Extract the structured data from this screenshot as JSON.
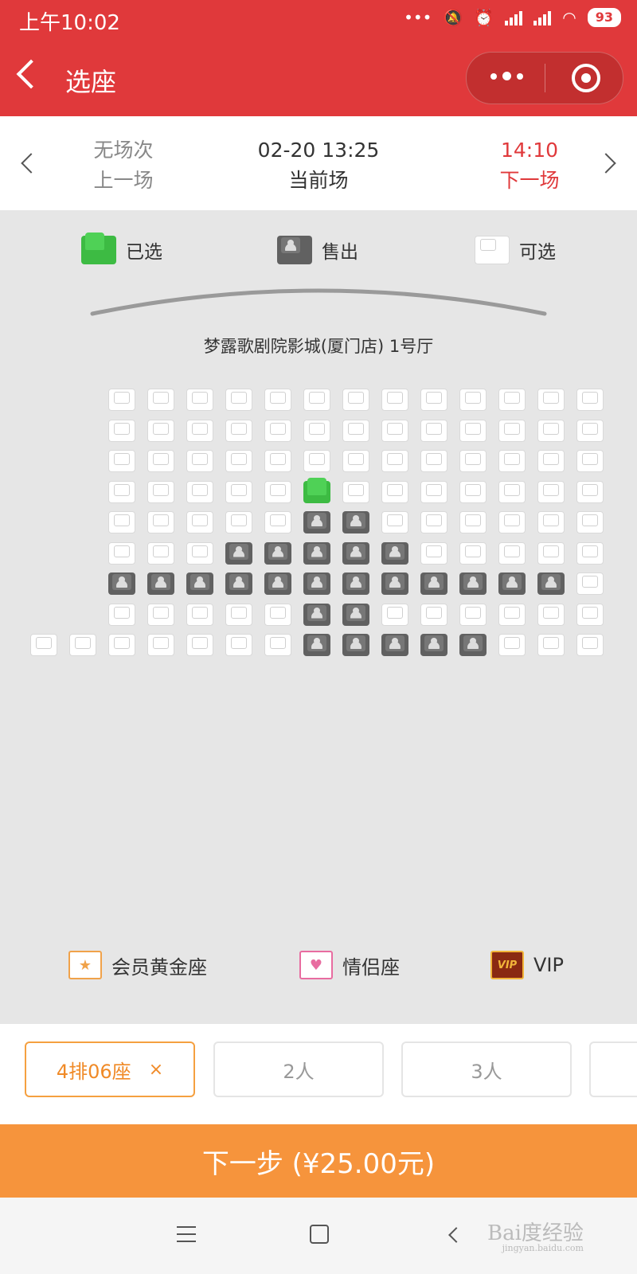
{
  "status_bar": {
    "time": "上午10:02",
    "battery": "93"
  },
  "header": {
    "title": "选座"
  },
  "session": {
    "prev": {
      "time": "无场次",
      "label": "上一场"
    },
    "current": {
      "time": "02-20 13:25",
      "label": "当前场"
    },
    "next": {
      "time": "14:10",
      "label": "下一场"
    }
  },
  "legend": {
    "selected": "已选",
    "sold": "售出",
    "available": "可选"
  },
  "hall_name": "梦露歌剧院影城(厦门店) 1号厅",
  "seat_map": {
    "rows": [
      [
        "",
        "",
        "A",
        "A",
        "A",
        "A",
        "A",
        "A",
        "A",
        "A",
        "A",
        "A",
        "A",
        "A",
        "A"
      ],
      [
        "",
        "",
        "A",
        "A",
        "A",
        "A",
        "A",
        "A",
        "A",
        "A",
        "A",
        "A",
        "A",
        "A",
        "A"
      ],
      [
        "",
        "",
        "A",
        "A",
        "A",
        "A",
        "A",
        "A",
        "A",
        "A",
        "A",
        "A",
        "A",
        "A",
        "A"
      ],
      [
        "",
        "",
        "A",
        "A",
        "A",
        "A",
        "A",
        "C",
        "A",
        "A",
        "A",
        "A",
        "A",
        "A",
        "A"
      ],
      [
        "",
        "",
        "A",
        "A",
        "A",
        "A",
        "A",
        "S",
        "S",
        "A",
        "A",
        "A",
        "A",
        "A",
        "A"
      ],
      [
        "",
        "",
        "A",
        "A",
        "A",
        "S",
        "S",
        "S",
        "S",
        "S",
        "A",
        "A",
        "A",
        "A",
        "A"
      ],
      [
        "",
        "",
        "S",
        "S",
        "S",
        "S",
        "S",
        "S",
        "S",
        "S",
        "S",
        "S",
        "S",
        "S",
        "A"
      ],
      [
        "",
        "",
        "A",
        "A",
        "A",
        "A",
        "A",
        "S",
        "S",
        "A",
        "A",
        "A",
        "A",
        "A",
        "A"
      ],
      [
        "A",
        "A",
        "A",
        "A",
        "A",
        "A",
        "A",
        "S",
        "S",
        "S",
        "S",
        "S",
        "A",
        "A",
        "A"
      ]
    ]
  },
  "seat_types": {
    "gold": "会员黄金座",
    "couple": "情侣座",
    "vip": "VIP",
    "vip_badge": "VIP"
  },
  "chips": {
    "selected_seat": "4排06座",
    "close": "×",
    "two": "2人",
    "three": "3人"
  },
  "next_button": "下一步 (¥25.00元)",
  "watermark": {
    "main": "Bai度经验",
    "sub": "jingyan.baidu.com"
  },
  "colors": {
    "header": "#e0393b",
    "selected": "#3dbb43",
    "sold": "#616161",
    "cta": "#f6943c",
    "chip_active": "#f08a27"
  }
}
